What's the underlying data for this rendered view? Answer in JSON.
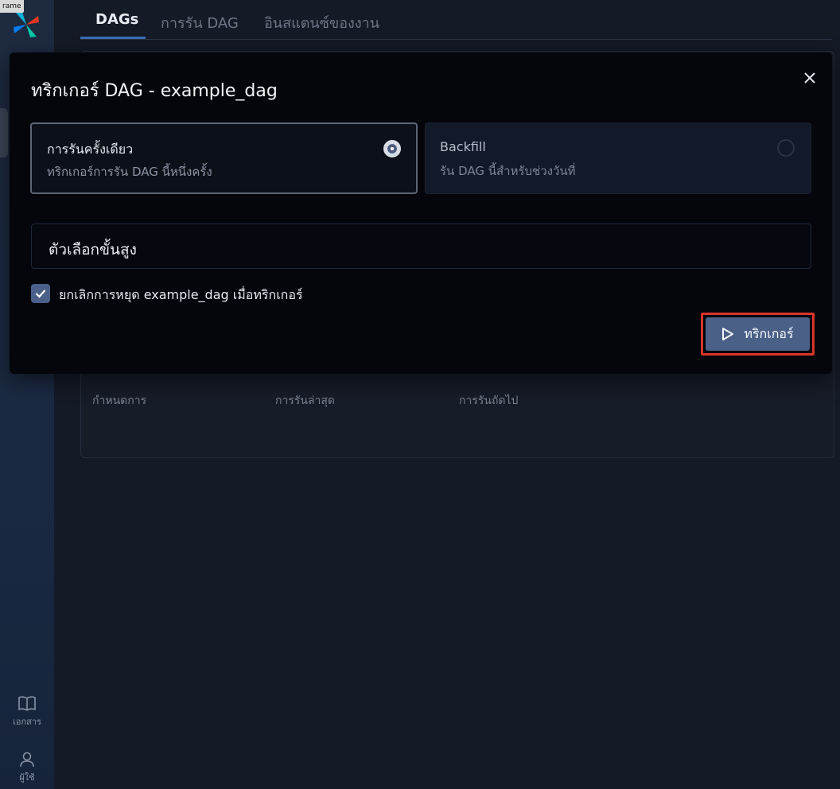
{
  "frame_tag": "rame",
  "sidebar": {
    "docs_label": "เอกสาร",
    "user_label": "ผู้ใช้"
  },
  "tabs": [
    {
      "label": "DAGs",
      "active": true
    },
    {
      "label": "การรัน DAG",
      "active": false
    },
    {
      "label": "อินสแตนซ์ของงาน",
      "active": false
    }
  ],
  "table": {
    "columns": [
      "กำหนดการ",
      "การรันล่าสุด",
      "การรันถัดไป"
    ]
  },
  "dialog": {
    "title": "ทริกเกอร์ DAG - example_dag",
    "options": [
      {
        "title": "การรันครั้งเดียว",
        "description": "ทริกเกอร์การรัน DAG นี้หนึ่งครั้ง",
        "selected": true
      },
      {
        "title": "Backfill",
        "description": "รัน DAG นี้สำหรับช่วงวันที่",
        "selected": false
      }
    ],
    "advanced_label": "ตัวเลือกขั้นสูง",
    "unpause_checkbox": {
      "label": "ยกเลิกการหยุด example_dag เมื่อทริกเกอร์",
      "checked": true
    },
    "trigger_label": "ทริกเกอร์"
  },
  "colors": {
    "accent": "#3b6db5",
    "button": "#4a6087",
    "highlight": "#d8342a"
  }
}
